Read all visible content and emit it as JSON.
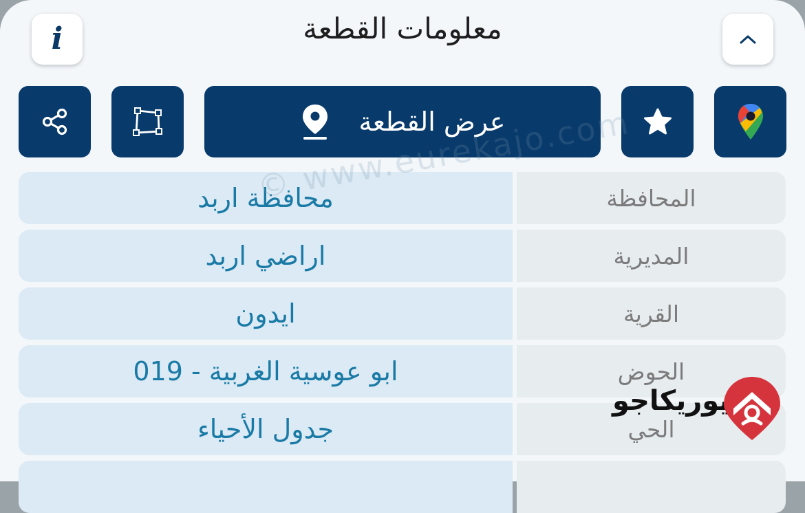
{
  "header": {
    "title": "معلومات القطعة",
    "info_icon": "info-icon",
    "collapse_icon": "chevron-up-icon"
  },
  "actions": {
    "view_label": "عرض القطعة",
    "view_icon": "map-pin-icon",
    "share_icon": "share-icon",
    "polygon_icon": "polygon-icon",
    "favorite_icon": "star-icon",
    "maps_icon": "google-maps-icon"
  },
  "rows": [
    {
      "label": "المحافظة",
      "value": "محافظة اربد"
    },
    {
      "label": "المديرية",
      "value": "اراضي اربد"
    },
    {
      "label": "القرية",
      "value": "ايدون"
    },
    {
      "label": "الحوض",
      "value": "ابو عوسية الغربية - 019"
    },
    {
      "label": "الحي",
      "value": "جدول الأحياء"
    }
  ],
  "watermark": "© www.eurekajo.com",
  "logo": {
    "text": "يوريكاجو",
    "icon": "eurekajo-logo-icon"
  },
  "colors": {
    "accent": "#083a6b",
    "value_text": "#1a7aa6",
    "label_text": "#7b7b7b"
  }
}
